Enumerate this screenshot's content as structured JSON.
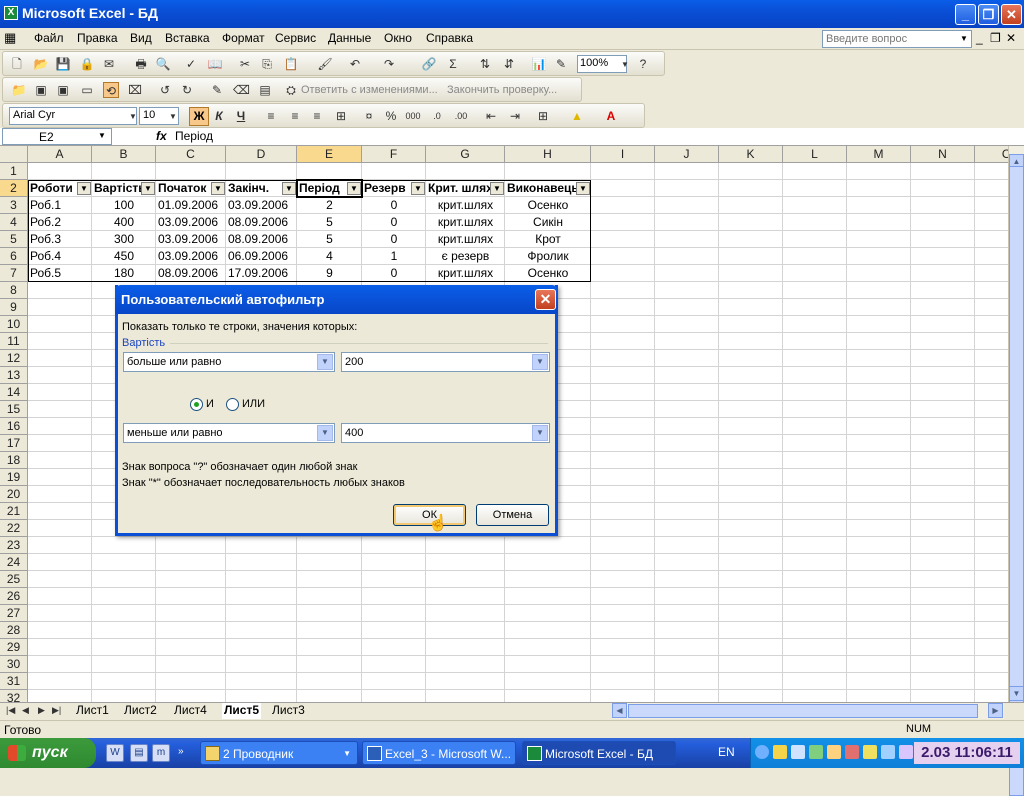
{
  "window": {
    "title": "Microsoft Excel - БД"
  },
  "menu": {
    "items": [
      "Файл",
      "Правка",
      "Вид",
      "Вставка",
      "Формат",
      "Сервис",
      "Данные",
      "Окно",
      "Справка"
    ],
    "ask_placeholder": "Введите вопрос"
  },
  "toolbar": {
    "zoom": "100%",
    "reply_hint": "Ответить с изменениями...",
    "end_review": "Закончить проверку...",
    "font_name": "Arial Cyr",
    "font_size": "10",
    "bold_glyph": "Ж",
    "italic_glyph": "К",
    "underline_glyph": "Ч"
  },
  "formula_bar": {
    "name_box": "E2",
    "fx": "fx",
    "value": "Період"
  },
  "grid": {
    "columns": [
      "A",
      "B",
      "C",
      "D",
      "E",
      "F",
      "G",
      "H",
      "I",
      "J",
      "K",
      "L",
      "M",
      "N",
      "O"
    ],
    "row_numbers": [
      "1",
      "2",
      "3",
      "4",
      "5",
      "6",
      "7",
      "8",
      "9",
      "10",
      "11",
      "12",
      "13",
      "14",
      "15",
      "16",
      "17",
      "18",
      "19",
      "20",
      "21",
      "22",
      "23",
      "24",
      "25",
      "26",
      "27",
      "28",
      "29",
      "30",
      "31",
      "32"
    ],
    "selected_column": "E",
    "selected_row": "2",
    "headers": [
      "Роботи",
      "Вартість",
      "Початок",
      "Закінч.",
      "Період",
      "Резерв",
      "Крит. шлях",
      "Виконавець"
    ],
    "rows": [
      [
        "Роб.1",
        "100",
        "01.09.2006",
        "03.09.2006",
        "2",
        "0",
        "крит.шлях",
        "Осенко"
      ],
      [
        "Роб.2",
        "400",
        "03.09.2006",
        "08.09.2006",
        "5",
        "0",
        "крит.шлях",
        "Сикін"
      ],
      [
        "Роб.3",
        "300",
        "03.09.2006",
        "08.09.2006",
        "5",
        "0",
        "крит.шлях",
        "Крот"
      ],
      [
        "Роб.4",
        "450",
        "03.09.2006",
        "06.09.2006",
        "4",
        "1",
        "є резерв",
        "Фролик"
      ],
      [
        "Роб.5",
        "180",
        "08.09.2006",
        "17.09.2006",
        "9",
        "0",
        "крит.шлях",
        "Осенко"
      ]
    ]
  },
  "sheet_tabs": {
    "tabs": [
      "Лист1",
      "Лист2",
      "Лист4",
      "Лист5",
      "Лист3"
    ],
    "active": "Лист5"
  },
  "status": {
    "left": "Готово",
    "num": "NUM"
  },
  "taskbar": {
    "start": "пуск",
    "tasks": [
      "2 Проводник",
      "Excel_3 - Microsoft W...",
      "Microsoft Excel - БД"
    ],
    "lang": "EN",
    "clock": "2.03 11:06:11"
  },
  "dialog": {
    "title": "Пользовательский автофильтр",
    "instruction": "Показать только те строки, значения которых:",
    "field": "Вартість",
    "op1": "больше или равно",
    "val1": "200",
    "and_label": "И",
    "or_label": "ИЛИ",
    "selected_logic": "И",
    "op2": "меньше или равно",
    "val2": "400",
    "hint1": "Знак вопроса \"?\" обозначает один любой знак",
    "hint2": "Знак \"*\" обозначает последовательность любых знаков",
    "ok": "ОК",
    "cancel": "Отмена"
  }
}
